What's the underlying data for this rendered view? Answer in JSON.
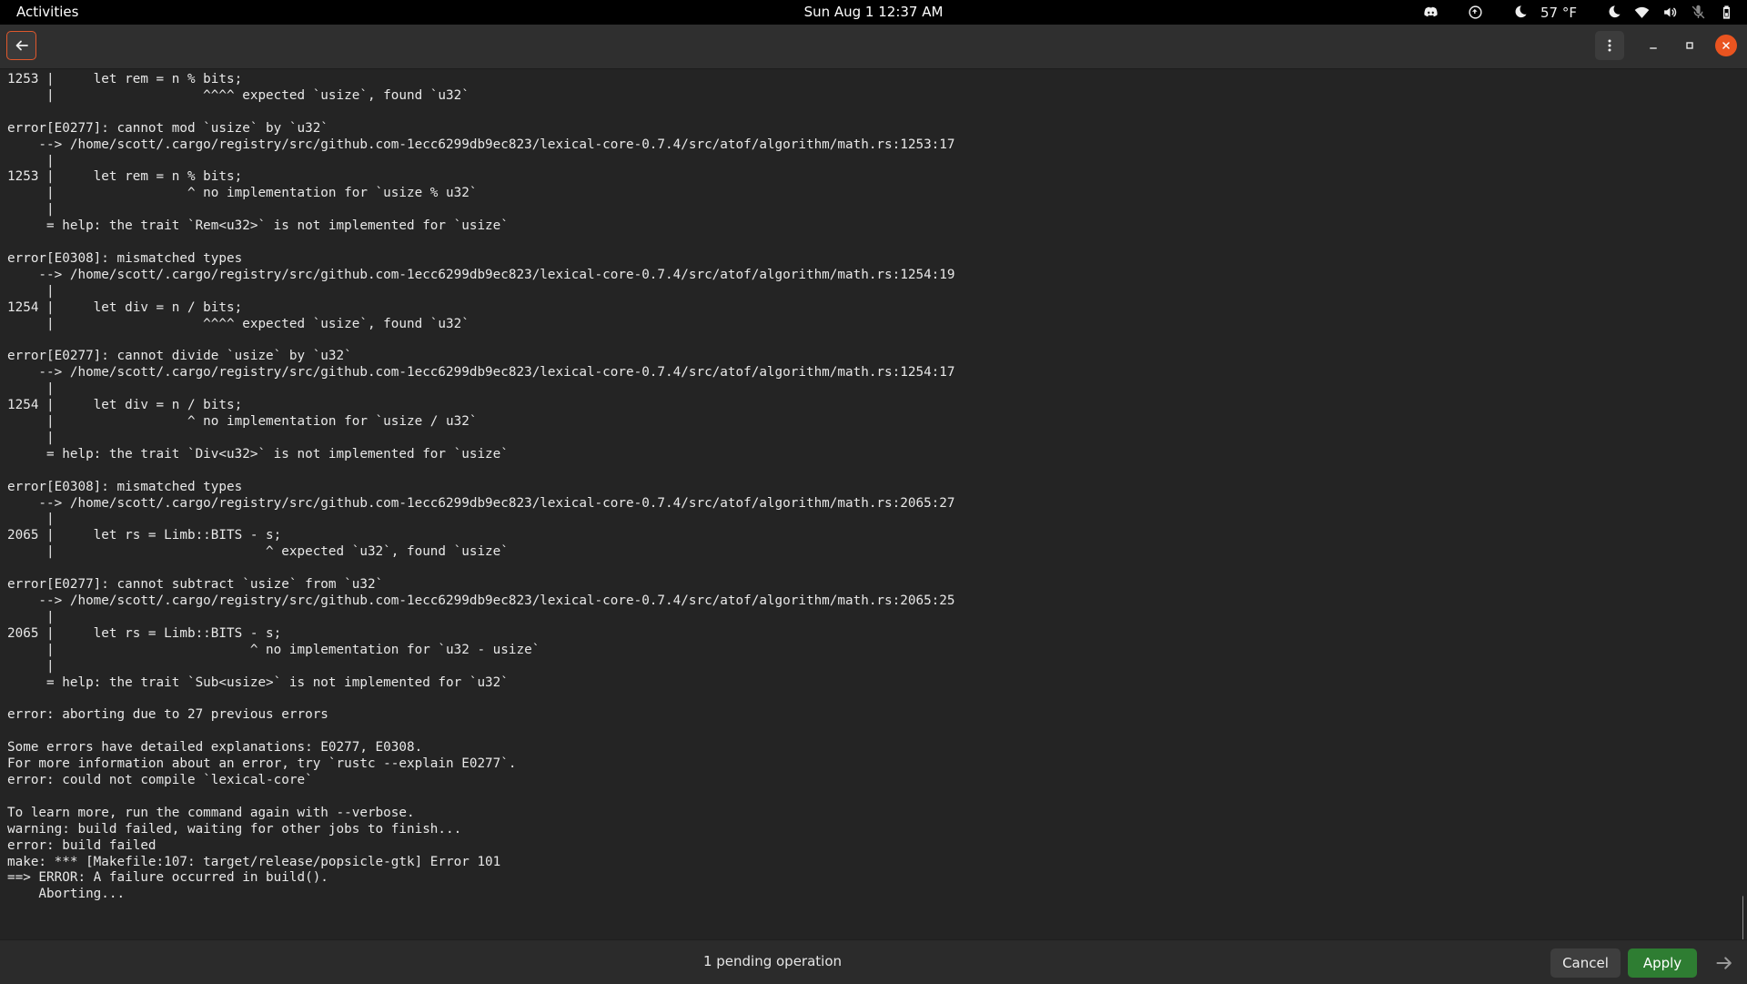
{
  "topbar": {
    "activities": "Activities",
    "clock": "Sun Aug 1  12:37 AM",
    "weather": "57 °F",
    "icons": [
      "discord-icon",
      "sync-icon",
      "moon-icon",
      "moon-icon",
      "wifi-icon",
      "volume-icon",
      "mic-muted-icon",
      "battery-icon"
    ]
  },
  "header": {
    "back_icon": "arrow-left-icon",
    "menu_icon": "kebab-menu-icon",
    "accent": "#e0582c",
    "close_color": "#e95420"
  },
  "terminal": {
    "lines": [
      "1253 |     let rem = n % bits;",
      "     |                   ^^^^ expected `usize`, found `u32`",
      "",
      "error[E0277]: cannot mod `usize` by `u32`",
      "    --> /home/scott/.cargo/registry/src/github.com-1ecc6299db9ec823/lexical-core-0.7.4/src/atof/algorithm/math.rs:1253:17",
      "     |",
      "1253 |     let rem = n % bits;",
      "     |                 ^ no implementation for `usize % u32`",
      "     |",
      "     = help: the trait `Rem<u32>` is not implemented for `usize`",
      "",
      "error[E0308]: mismatched types",
      "    --> /home/scott/.cargo/registry/src/github.com-1ecc6299db9ec823/lexical-core-0.7.4/src/atof/algorithm/math.rs:1254:19",
      "     |",
      "1254 |     let div = n / bits;",
      "     |                   ^^^^ expected `usize`, found `u32`",
      "",
      "error[E0277]: cannot divide `usize` by `u32`",
      "    --> /home/scott/.cargo/registry/src/github.com-1ecc6299db9ec823/lexical-core-0.7.4/src/atof/algorithm/math.rs:1254:17",
      "     |",
      "1254 |     let div = n / bits;",
      "     |                 ^ no implementation for `usize / u32`",
      "     |",
      "     = help: the trait `Div<u32>` is not implemented for `usize`",
      "",
      "error[E0308]: mismatched types",
      "    --> /home/scott/.cargo/registry/src/github.com-1ecc6299db9ec823/lexical-core-0.7.4/src/atof/algorithm/math.rs:2065:27",
      "     |",
      "2065 |     let rs = Limb::BITS - s;",
      "     |                           ^ expected `u32`, found `usize`",
      "",
      "error[E0277]: cannot subtract `usize` from `u32`",
      "    --> /home/scott/.cargo/registry/src/github.com-1ecc6299db9ec823/lexical-core-0.7.4/src/atof/algorithm/math.rs:2065:25",
      "     |",
      "2065 |     let rs = Limb::BITS - s;",
      "     |                         ^ no implementation for `u32 - usize`",
      "     |",
      "     = help: the trait `Sub<usize>` is not implemented for `u32`",
      "",
      "error: aborting due to 27 previous errors",
      "",
      "Some errors have detailed explanations: E0277, E0308.",
      "For more information about an error, try `rustc --explain E0277`.",
      "error: could not compile `lexical-core`",
      "",
      "To learn more, run the command again with --verbose.",
      "warning: build failed, waiting for other jobs to finish...",
      "error: build failed",
      "make: *** [Makefile:107: target/release/popsicle-gtk] Error 101",
      "==> ERROR: A failure occurred in build().",
      "    Aborting..."
    ]
  },
  "bottombar": {
    "pending": "1 pending operation",
    "cancel_label": "Cancel",
    "apply_label": "Apply",
    "apply_color": "#2e7d32",
    "next_icon": "arrow-right-icon"
  }
}
